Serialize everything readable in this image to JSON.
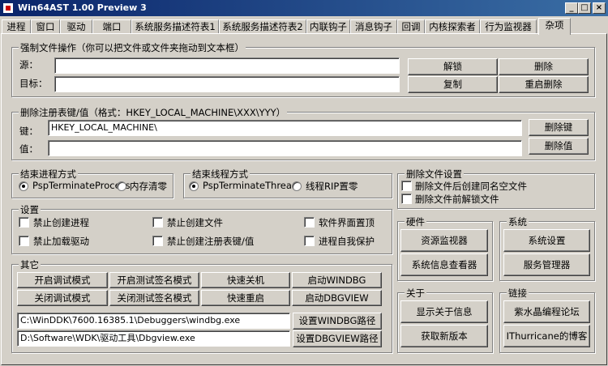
{
  "window": {
    "title": "Win64AST 1.00 Preview 3",
    "minimize": "_",
    "maximize": "□",
    "close": "×"
  },
  "tabs": [
    "进程",
    "窗口",
    "驱动",
    "端口",
    "系统服务描述符表1",
    "系统服务描述符表2",
    "内联钩子",
    "消息钩子",
    "回调",
    "内核探索者",
    "行为监视器",
    "杂项"
  ],
  "active_tab": "杂项",
  "force_file": {
    "title": "强制文件操作（你可以把文件或文件夹拖动到文本框）",
    "source_label": "源：",
    "target_label": "目标：",
    "source_value": "",
    "target_value": "",
    "unlock": "解锁",
    "delete": "删除",
    "copy": "复制",
    "reboot_delete": "重启删除"
  },
  "registry": {
    "title": "删除注册表键/值（格式：HKEY_LOCAL_MACHINE\\XXX\\YYY）",
    "key_label": "键：",
    "value_label": "值：",
    "key_value": "HKEY_LOCAL_MACHINE\\",
    "value_value": "",
    "delete_key": "删除键",
    "delete_value": "删除值"
  },
  "end_process": {
    "title": "结束进程方式",
    "opt1": "PspTerminateProcess",
    "opt2": "内存清零"
  },
  "end_thread": {
    "title": "结束线程方式",
    "opt1": "PspTerminateThread",
    "opt2": "线程RIP置零"
  },
  "delete_file_settings": {
    "title": "删除文件设置",
    "opt1": "删除文件后创建同名空文件",
    "opt2": "删除文件前解锁文件"
  },
  "settings": {
    "title": "设置",
    "no_create_process": "禁止创建进程",
    "no_load_driver": "禁止加载驱动",
    "no_create_file": "禁止创建文件",
    "no_create_reg": "禁止创建注册表键/值",
    "topmost": "软件界面置顶",
    "self_protect": "进程自我保护"
  },
  "hardware": {
    "title": "硬件",
    "resource_monitor": "资源监视器",
    "sysinfo": "系统信息查看器"
  },
  "system": {
    "title": "系统",
    "sys_settings": "系统设置",
    "service_manager": "服务管理器"
  },
  "other": {
    "title": "其它",
    "debug_on": "开启调试模式",
    "testsign_on": "开启测试签名模式",
    "fast_shutdown": "快速关机",
    "start_windbg": "启动WINDBG",
    "debug_off": "关闭调试模式",
    "testsign_off": "关闭测试签名模式",
    "fast_reboot": "快速重启",
    "start_dbgview": "启动DBGVIEW",
    "windbg_path": "C:\\WinDDK\\7600.16385.1\\Debuggers\\windbg.exe",
    "dbgview_path": "D:\\Software\\WDK\\驱动工具\\Dbgview.exe",
    "set_windbg": "设置WINDBG路径",
    "set_dbgview": "设置DBGVIEW路径"
  },
  "about": {
    "title": "关于",
    "show_info": "显示关于信息",
    "get_new": "获取新版本"
  },
  "links": {
    "title": "链接",
    "forum": "紫水晶编程论坛",
    "blog": "IThurricane的博客"
  }
}
